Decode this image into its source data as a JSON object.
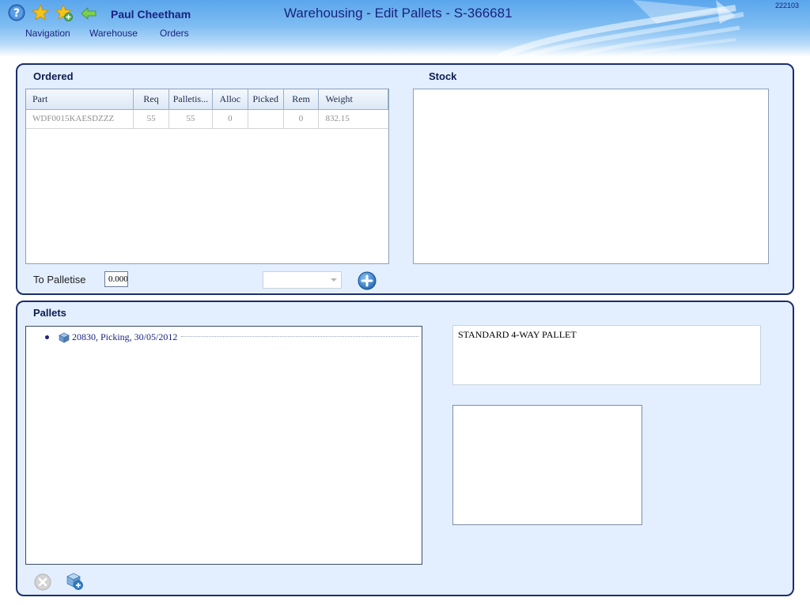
{
  "header": {
    "user_name": "Paul Cheetham",
    "title": "Warehousing - Edit Pallets - S-366681",
    "build": "222103",
    "icons": [
      "help-icon",
      "star-icon",
      "star-add-icon",
      "back-arrow-icon"
    ],
    "menu": [
      {
        "label": "Navigation"
      },
      {
        "label": "Warehouse"
      },
      {
        "label": "Orders"
      }
    ]
  },
  "ordered": {
    "title": "Ordered",
    "columns": [
      "Part",
      "Req",
      "Palletis...",
      "Alloc",
      "Picked",
      "Rem",
      "Weight"
    ],
    "rows": [
      {
        "part": "WDF0015KAESDZZZ",
        "req": "55",
        "palletised": "55",
        "alloc": "0",
        "picked": "",
        "rem": "0",
        "weight": "832.15"
      }
    ],
    "to_palletise_label": "To Palletise",
    "to_palletise_value": "0.000",
    "dropdown_value": ""
  },
  "stock": {
    "title": "Stock"
  },
  "pallets": {
    "title": "Pallets",
    "tree": [
      {
        "label": "20830, Picking, 30/05/2012"
      }
    ],
    "pallet_type": "STANDARD 4-WAY PALLET"
  },
  "colors": {
    "panel_bg": "#e3efff",
    "panel_border": "#1c2e6e",
    "accent": "#1a237e",
    "add_button": "#2f7fd0"
  }
}
